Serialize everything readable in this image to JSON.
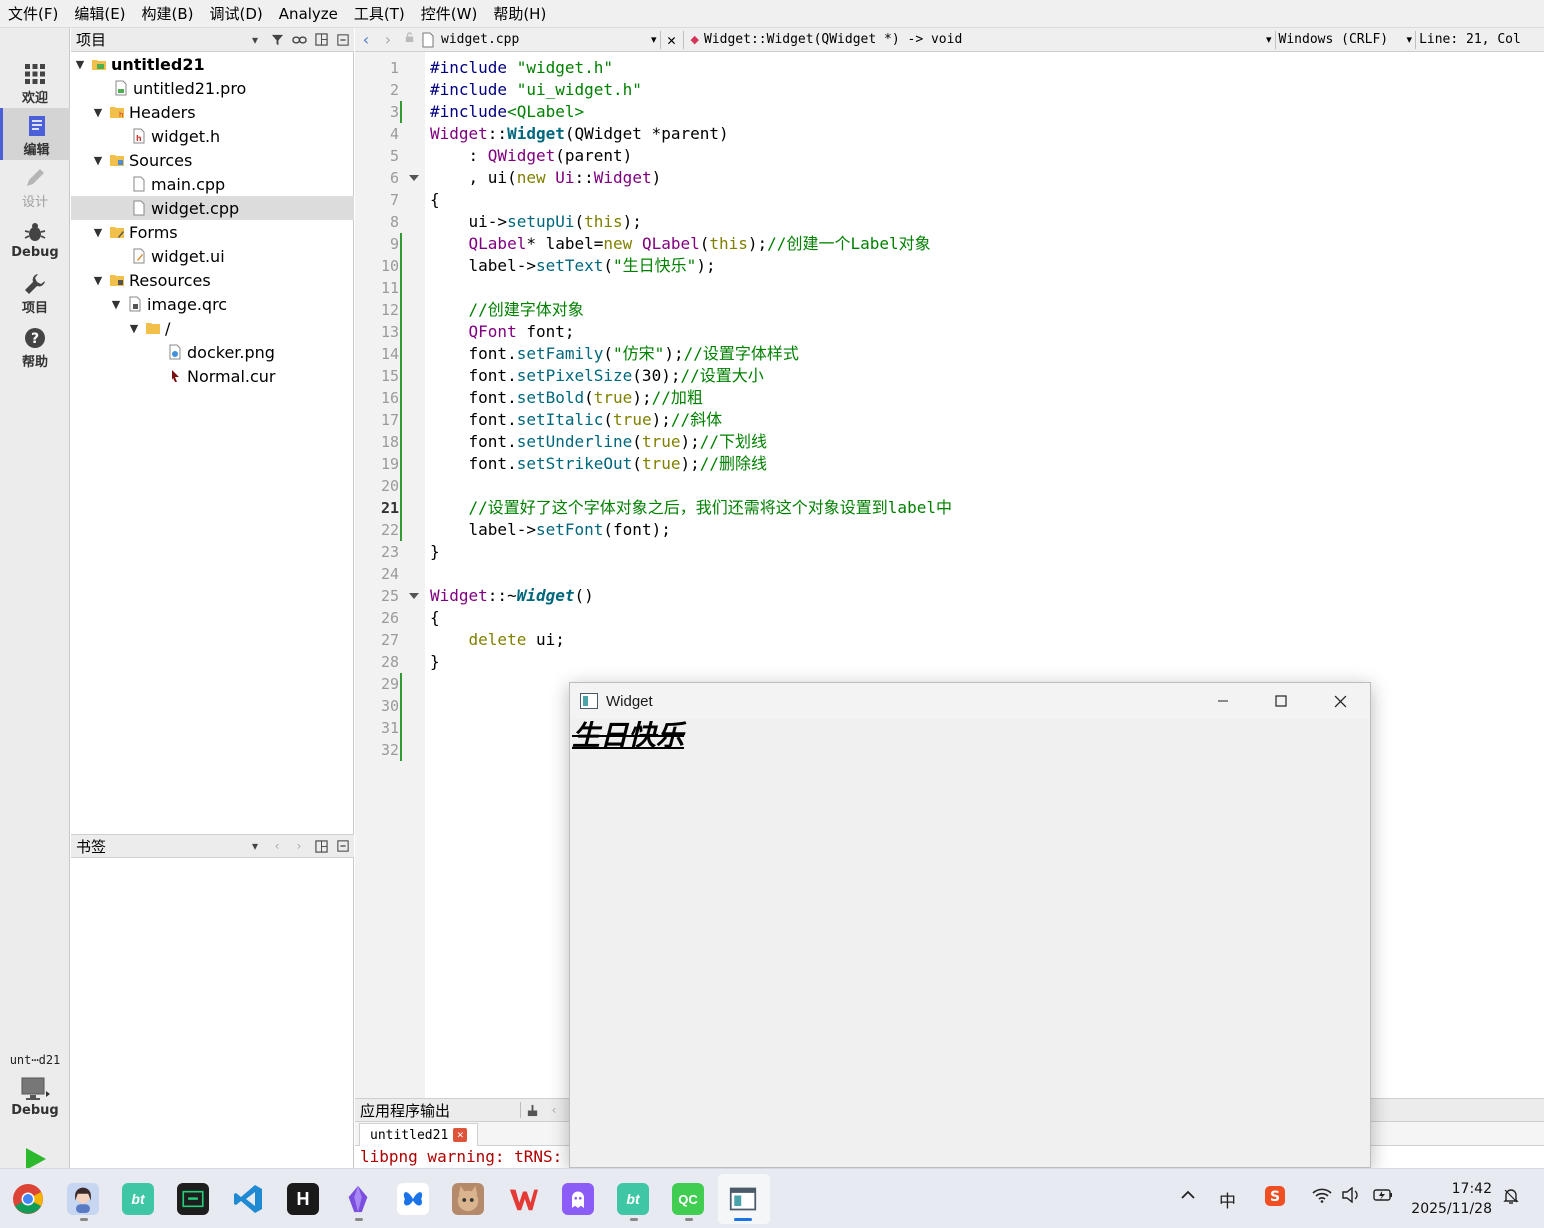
{
  "menu": [
    "文件(F)",
    "编辑(E)",
    "构建(B)",
    "调试(D)",
    "Analyze",
    "工具(T)",
    "控件(W)",
    "帮助(H)"
  ],
  "modes": [
    {
      "label": "欢迎",
      "icon": "grid-icon"
    },
    {
      "label": "编辑",
      "icon": "document-icon"
    },
    {
      "label": "设计",
      "icon": "pencil-icon"
    },
    {
      "label": "Debug",
      "icon": "bug-icon"
    },
    {
      "label": "项目",
      "icon": "wrench-icon"
    },
    {
      "label": "帮助",
      "icon": "help-icon"
    }
  ],
  "kit": {
    "name": "unt⋯d21",
    "mode": "Debug"
  },
  "project_panel": {
    "title": "项目"
  },
  "tree": [
    {
      "label": "untitled21",
      "depth": 0,
      "expanded": true,
      "icon": "project-icon",
      "bold": true
    },
    {
      "label": "untitled21.pro",
      "depth": 1,
      "icon": "pro-file-icon"
    },
    {
      "label": "Headers",
      "depth": 1,
      "expanded": true,
      "icon": "folder-h-icon"
    },
    {
      "label": "widget.h",
      "depth": 2,
      "icon": "header-file-icon"
    },
    {
      "label": "Sources",
      "depth": 1,
      "expanded": true,
      "icon": "folder-src-icon"
    },
    {
      "label": "main.cpp",
      "depth": 2,
      "icon": "cpp-file-icon"
    },
    {
      "label": "widget.cpp",
      "depth": 2,
      "icon": "cpp-file-icon",
      "selected": true
    },
    {
      "label": "Forms",
      "depth": 1,
      "expanded": true,
      "icon": "folder-forms-icon"
    },
    {
      "label": "widget.ui",
      "depth": 2,
      "icon": "ui-file-icon"
    },
    {
      "label": "Resources",
      "depth": 1,
      "expanded": true,
      "icon": "folder-res-icon"
    },
    {
      "label": "image.qrc",
      "depth": 2,
      "expanded": true,
      "icon": "qrc-file-icon"
    },
    {
      "label": "/",
      "depth": 3,
      "expanded": true,
      "icon": "folder-icon"
    },
    {
      "label": "docker.png",
      "depth": 4,
      "icon": "image-file-icon"
    },
    {
      "label": "Normal.cur",
      "depth": 4,
      "icon": "cursor-file-icon"
    }
  ],
  "bookmarks_panel": {
    "title": "书签"
  },
  "editor": {
    "file": "widget.cpp",
    "symbol": "Widget::Widget(QWidget *) -> void",
    "line_ending": "Windows (CRLF)",
    "position": "Line: 21, Col",
    "current_line": 21,
    "changed_lines": [
      3,
      9,
      10,
      11,
      12,
      13,
      14,
      15,
      16,
      17,
      18,
      19,
      20,
      21,
      22,
      29,
      30,
      31,
      32
    ],
    "fold_lines": [
      6,
      25
    ],
    "lines": [
      "#include \"widget.h\"",
      "#include \"ui_widget.h\"",
      "#include<QLabel>",
      "Widget::Widget(QWidget *parent)",
      "    : QWidget(parent)",
      "    , ui(new Ui::Widget)",
      "{",
      "    ui->setupUi(this);",
      "    QLabel* label=new QLabel(this);//创建一个Label对象",
      "    label->setText(\"生日快乐\");",
      "",
      "    //创建字体对象",
      "    QFont font;",
      "    font.setFamily(\"仿宋\");//设置字体样式",
      "    font.setPixelSize(30);//设置大小",
      "    font.setBold(true);//加粗",
      "    font.setItalic(true);//斜体",
      "    font.setUnderline(true);//下划线",
      "    font.setStrikeOut(true);//删除线",
      "",
      "    //设置好了这个字体对象之后，我们还需将这个对象设置到label中",
      "    label->setFont(font);",
      "}",
      "",
      "Widget::~Widget()",
      "{",
      "    delete ui;",
      "}",
      "",
      "",
      "",
      ""
    ]
  },
  "output": {
    "title": "应用程序输出",
    "tab": "untitled21",
    "text": "libpng warning: tRNS:"
  },
  "widget_window": {
    "title": "Widget",
    "label": "生日快乐"
  },
  "taskbar": {
    "apps": [
      "chrome-icon",
      "avatar-app-icon",
      "bt-app-icon",
      "terminal-app-icon",
      "vscode-icon",
      "h-app-icon",
      "crystal-app-icon",
      "butterfly-app-icon",
      "cat-app-icon",
      "wps-icon",
      "ghost-app-icon",
      "bt-app-icon-2",
      "qt-creator-icon",
      "widget-app-icon"
    ],
    "ime": "中",
    "time": "17:42",
    "date": "2025/11/28"
  }
}
